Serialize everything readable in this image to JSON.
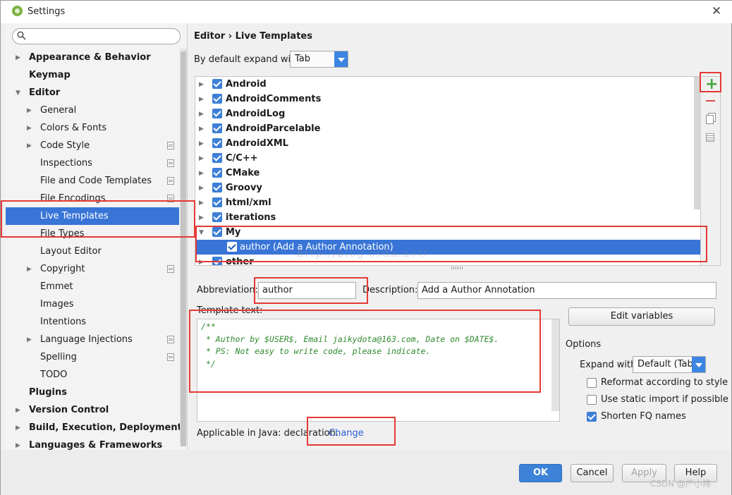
{
  "window": {
    "title": "Settings",
    "close_glyph": "✕"
  },
  "search": {
    "placeholder": ""
  },
  "sidebar": {
    "items": [
      {
        "label": "Appearance & Behavior",
        "level": 0,
        "bold": true,
        "arrow": "right"
      },
      {
        "label": "Keymap",
        "level": 0,
        "bold": true,
        "arrow": ""
      },
      {
        "label": "Editor",
        "level": 0,
        "bold": true,
        "arrow": "down"
      },
      {
        "label": "General",
        "level": 1,
        "arrow": "right"
      },
      {
        "label": "Colors & Fonts",
        "level": 1,
        "arrow": "right"
      },
      {
        "label": "Code Style",
        "level": 1,
        "arrow": "right",
        "page_icon": true
      },
      {
        "label": "Inspections",
        "level": 1,
        "arrow": "",
        "page_icon": true
      },
      {
        "label": "File and Code Templates",
        "level": 1,
        "arrow": "",
        "page_icon": true
      },
      {
        "label": "File Encodings",
        "level": 1,
        "arrow": "",
        "page_icon": true
      },
      {
        "label": "Live Templates",
        "level": 1,
        "arrow": "",
        "selected": true
      },
      {
        "label": "File Types",
        "level": 1,
        "arrow": ""
      },
      {
        "label": "Layout Editor",
        "level": 1,
        "arrow": ""
      },
      {
        "label": "Copyright",
        "level": 1,
        "arrow": "right",
        "page_icon": true
      },
      {
        "label": "Emmet",
        "level": 1,
        "arrow": ""
      },
      {
        "label": "Images",
        "level": 1,
        "arrow": ""
      },
      {
        "label": "Intentions",
        "level": 1,
        "arrow": ""
      },
      {
        "label": "Language Injections",
        "level": 1,
        "arrow": "right",
        "page_icon": true
      },
      {
        "label": "Spelling",
        "level": 1,
        "arrow": "",
        "page_icon": true
      },
      {
        "label": "TODO",
        "level": 1,
        "arrow": ""
      },
      {
        "label": "Plugins",
        "level": 0,
        "bold": true,
        "arrow": ""
      },
      {
        "label": "Version Control",
        "level": 0,
        "bold": true,
        "arrow": "right"
      },
      {
        "label": "Build, Execution, Deployment",
        "level": 0,
        "bold": true,
        "arrow": "right"
      },
      {
        "label": "Languages & Frameworks",
        "level": 0,
        "bold": true,
        "arrow": "right"
      }
    ]
  },
  "main": {
    "breadcrumb": "Editor › Live Templates",
    "expand_label": "By default expand with",
    "expand_value": "Tab",
    "templates": [
      {
        "label": "Android",
        "arrow": "right"
      },
      {
        "label": "AndroidComments",
        "arrow": "right"
      },
      {
        "label": "AndroidLog",
        "arrow": "right"
      },
      {
        "label": "AndroidParcelable",
        "arrow": "right"
      },
      {
        "label": "AndroidXML",
        "arrow": "right"
      },
      {
        "label": "C/C++",
        "arrow": "right"
      },
      {
        "label": "CMake",
        "arrow": "right"
      },
      {
        "label": "Groovy",
        "arrow": "right"
      },
      {
        "label": "html/xml",
        "arrow": "right"
      },
      {
        "label": "iterations",
        "arrow": "right"
      },
      {
        "label": "My",
        "arrow": "down"
      },
      {
        "label": "author (Add a Author Annotation)",
        "child": true,
        "selected": true
      },
      {
        "label": "other",
        "arrow": "right"
      }
    ],
    "abbreviation_label": "Abbreviation:",
    "abbreviation_value": "author",
    "description_label": "Description:",
    "description_value": "Add a Author Annotation",
    "template_text_label": "Template text:",
    "template_text": "/**\n * Author by $USER$, Email jaikydota@163.com, Date on $DATE$.\n * PS: Not easy to write code, please indicate.\n */",
    "applicable_label": "Applicable in Java: declaration.",
    "change_link": "Change",
    "edit_variables": "Edit variables",
    "options_label": "Options",
    "expand_with_label": "Expand with",
    "expand_with_value": "Default (Tab)",
    "options": [
      {
        "label": "Reformat according to style",
        "checked": false
      },
      {
        "label": "Use static import if possible",
        "checked": false
      },
      {
        "label": "Shorten FQ names",
        "checked": true
      }
    ],
    "overlay_url": "http://blog.csdn.net/"
  },
  "buttons": {
    "ok": "OK",
    "cancel": "Cancel",
    "apply": "Apply",
    "help": "Help"
  },
  "watermark": "CSDN @严小排",
  "icons": {
    "add": "add-icon",
    "remove": "remove-icon",
    "copy": "copy-icon",
    "list": "list-icon"
  },
  "colors": {
    "accent": "#3875d7",
    "annotation": "#e53935",
    "add": "#3fa63f",
    "remove": "#d94848",
    "code": "#2f8a2f"
  }
}
